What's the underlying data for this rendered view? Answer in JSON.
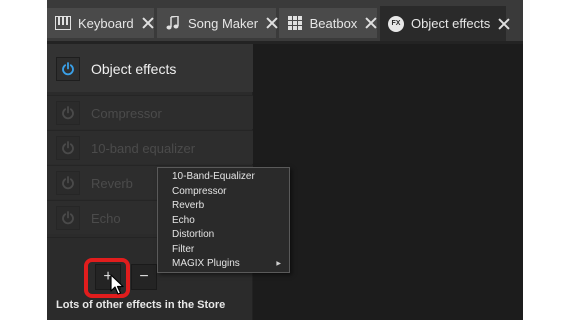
{
  "tabs": [
    {
      "label": "Keyboard",
      "icon": "keyboard-icon",
      "active": false
    },
    {
      "label": "Song Maker",
      "icon": "music-note-icon",
      "active": false
    },
    {
      "label": "Beatbox",
      "icon": "grid-icon",
      "active": false
    },
    {
      "label": "Object effects",
      "icon": "fx-icon",
      "active": true
    }
  ],
  "fx_icon_text": "FX",
  "panel": {
    "title": "Object effects",
    "effects": [
      "Compressor",
      "10-band equalizer",
      "Reverb",
      "Echo"
    ],
    "add_label": "+",
    "remove_label": "−",
    "store_text": "Lots of other effects in the Store"
  },
  "menu": {
    "items": [
      {
        "label": "10-Band-Equalizer"
      },
      {
        "label": "Compressor"
      },
      {
        "label": "Reverb"
      },
      {
        "label": "Echo"
      },
      {
        "label": "Distortion"
      },
      {
        "label": "Filter"
      },
      {
        "label": "MAGIX Plugins",
        "submenu": true
      }
    ]
  },
  "colors": {
    "highlight": "#e11d1d",
    "power_active": "#3aa0e8",
    "power_inactive": "#4a4a4a"
  }
}
